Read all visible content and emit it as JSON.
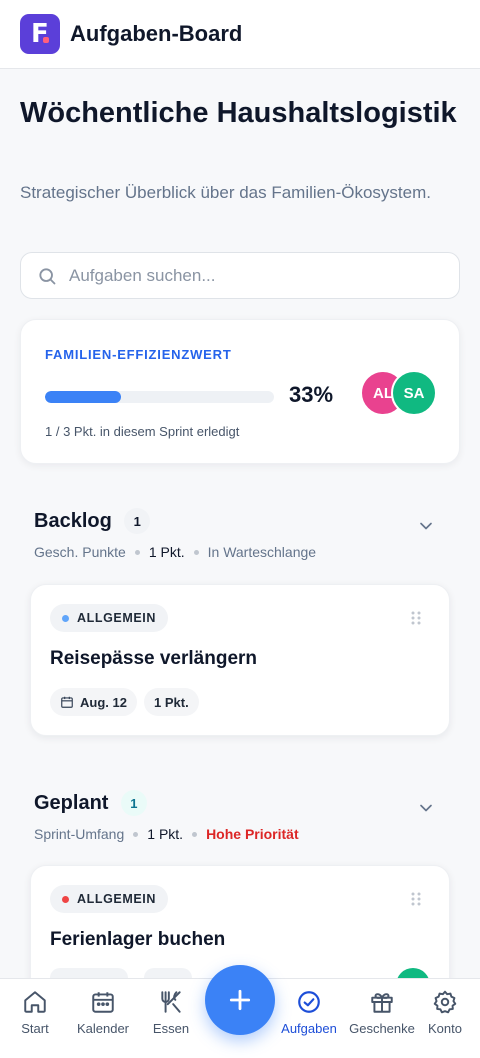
{
  "header": {
    "app_title": "Aufgaben-Board",
    "logo_letter": "F"
  },
  "page": {
    "title": "Wöchentliche Haushaltslogistik",
    "subtitle": "Strategischer Überblick über das Familien-Ökosystem."
  },
  "search": {
    "placeholder": "Aufgaben suchen..."
  },
  "efficiency": {
    "label": "FAMILIEN-EFFIZIENZWERT",
    "percent_text": "33%",
    "progress_fraction": 0.33,
    "note": "1 / 3 Pkt. in diesem Sprint erledigt",
    "avatars": [
      {
        "initials": "AL",
        "color": "#e9428f"
      },
      {
        "initials": "SA",
        "color": "#10b981"
      }
    ]
  },
  "sections": [
    {
      "title": "Backlog",
      "count": "1",
      "meta_label": "Gesch. Punkte",
      "meta_value": "1 Pkt.",
      "meta_status": "In Warteschlange",
      "tasks": [
        {
          "tag": "ALLGEMEIN",
          "tag_color": "#60a5fa",
          "title": "Reisepässe verlängern",
          "date": "Aug. 12",
          "points": "1 Pkt."
        }
      ]
    },
    {
      "title": "Geplant",
      "count": "1",
      "meta_label": "Sprint-Umfang",
      "meta_value": "1 Pkt.",
      "meta_status": "Hohe Priorität",
      "tasks": [
        {
          "tag": "ALLGEMEIN",
          "tag_color": "#ef4444",
          "title": "Ferienlager buchen"
        }
      ]
    }
  ],
  "nav": {
    "items": [
      {
        "label": "Start",
        "icon": "home-icon"
      },
      {
        "label": "Kalender",
        "icon": "calendar-icon"
      },
      {
        "label": "Essen",
        "icon": "utensils-icon"
      },
      {
        "label": "Aufgaben",
        "icon": "check-circle-icon",
        "active": true
      },
      {
        "label": "Geschenke",
        "icon": "gift-icon"
      },
      {
        "label": "Konto",
        "icon": "gear-icon"
      }
    ],
    "fab_icon": "plus-icon"
  },
  "colors": {
    "accent": "#3b82f6",
    "brand": "#5b3fd9",
    "priority": "#dc2626"
  }
}
